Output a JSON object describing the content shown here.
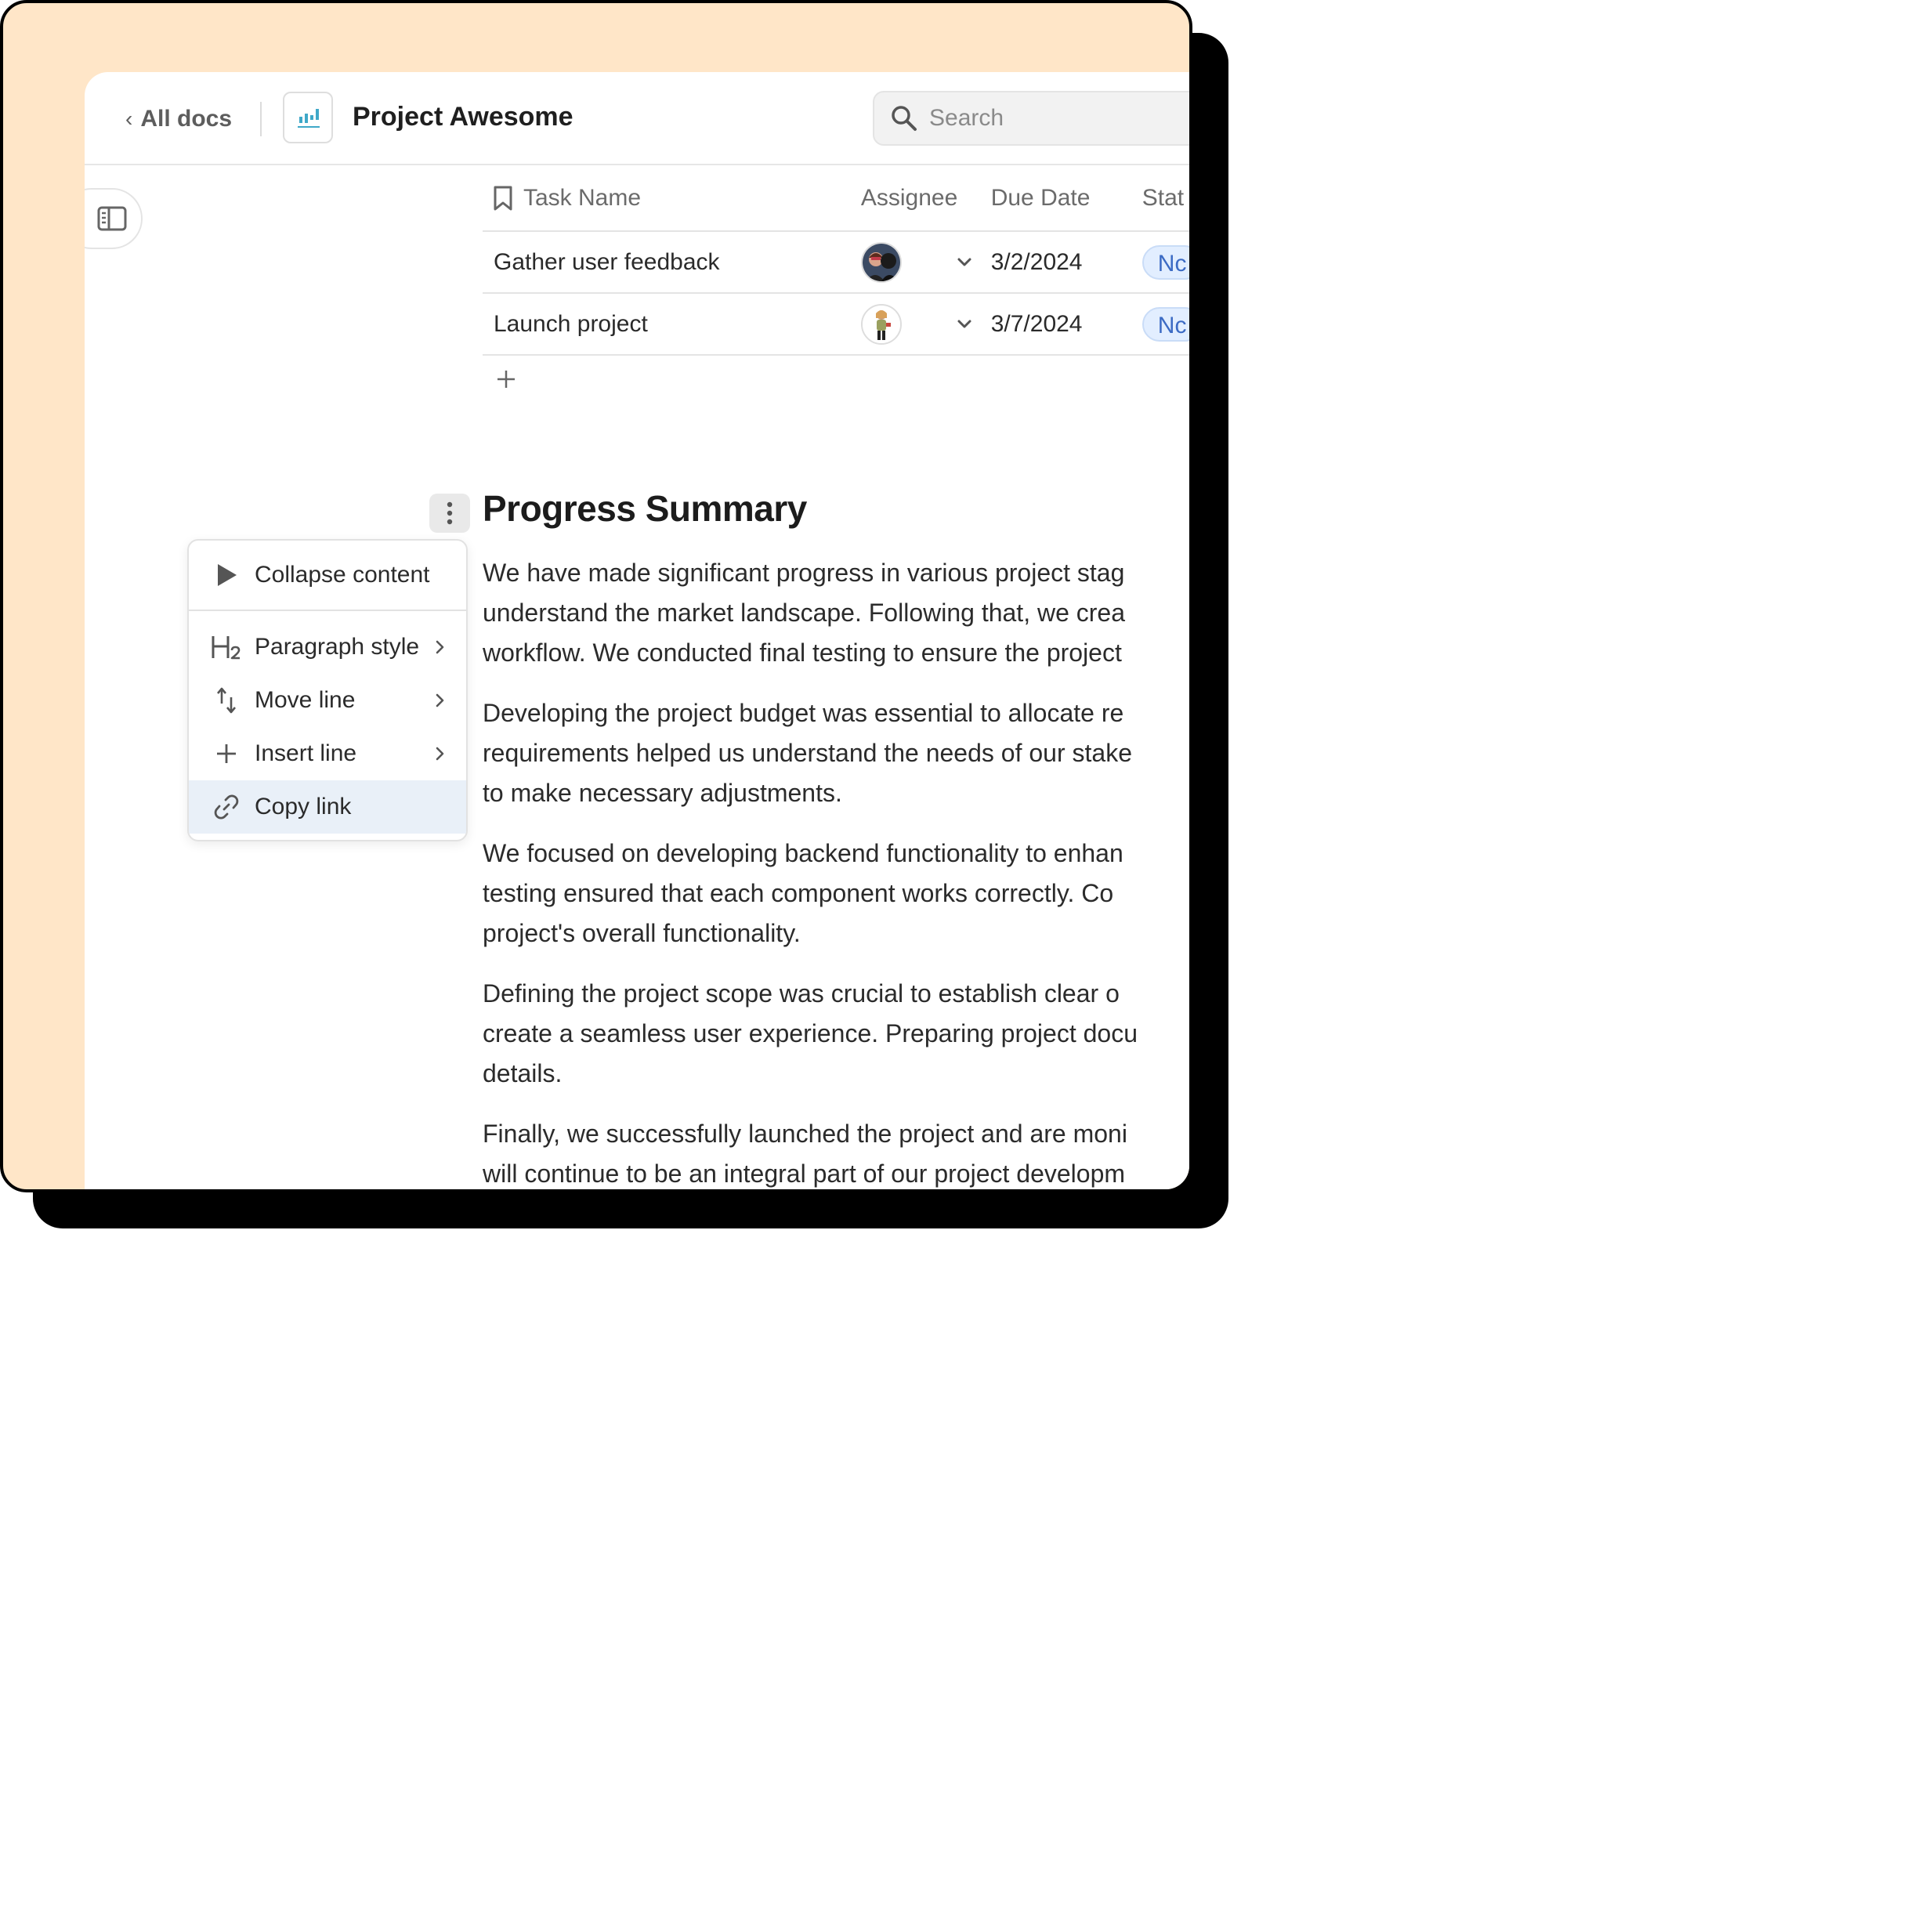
{
  "header": {
    "back_label": "All docs",
    "doc_title": "Project Awesome",
    "search_placeholder": "Search"
  },
  "table": {
    "columns": [
      "Task Name",
      "Assignee",
      "Due Date",
      "Stat"
    ],
    "rows": [
      {
        "task": "Gather user feedback",
        "due": "3/2/2024",
        "status": "Nc"
      },
      {
        "task": "Launch project",
        "due": "3/7/2024",
        "status": "Nc"
      }
    ]
  },
  "menu": {
    "items": [
      {
        "label": "Collapse content",
        "icon": "play-triangle-icon"
      },
      {
        "label": "Paragraph style",
        "icon": "heading-2-icon"
      },
      {
        "label": "Move line",
        "icon": "move-arrows-icon"
      },
      {
        "label": "Insert line",
        "icon": "plus-icon"
      },
      {
        "label": "Copy link",
        "icon": "link-icon"
      }
    ]
  },
  "content": {
    "heading": "Progress Summary",
    "paragraphs": [
      [
        "We have made significant progress in various project stag",
        "understand the market landscape. Following that, we crea",
        "workflow. We conducted final testing to ensure the project"
      ],
      [
        "Developing the project budget was essential to allocate re",
        "requirements helped us understand the needs of our stake",
        "to make necessary adjustments."
      ],
      [
        "We focused on developing backend functionality to enhan",
        "testing ensured that each component works correctly. Co",
        "project's overall functionality."
      ],
      [
        "Defining the project scope was crucial to establish clear o",
        "create a seamless user experience. Preparing project docu",
        "details."
      ],
      [
        "Finally, we successfully launched the project and are moni",
        "will continue to be an integral part of our project developm"
      ]
    ]
  },
  "colors": {
    "frame_bg": "#ffe6c8",
    "status_pill_bg": "#e2eeff",
    "status_text": "#3c6bc4",
    "menu_active_bg": "#e9f0f8",
    "brand_icon": "#3fa8c8"
  }
}
